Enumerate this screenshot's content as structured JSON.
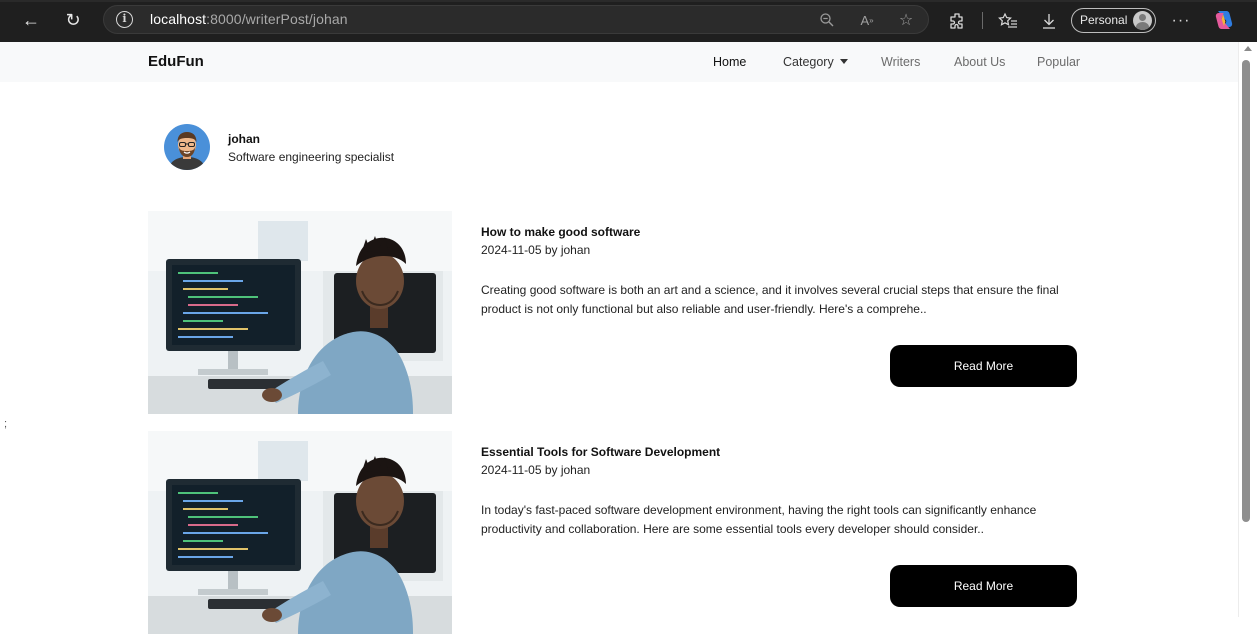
{
  "browser": {
    "url_host": "localhost",
    "url_path": ":8000/writerPost/johan",
    "profile_label": "Personal",
    "icons": [
      "back-arrow-icon",
      "reload-icon",
      "info-icon",
      "zoom-icon",
      "read-aloud-icon",
      "favorite-star-icon",
      "extensions-icon",
      "favorites-icon",
      "download-icon",
      "more-icon",
      "copilot-icon"
    ]
  },
  "navbar": {
    "brand": "EduFun",
    "links": {
      "home": "Home",
      "category": "Category",
      "writers": "Writers",
      "about": "About Us",
      "popular": "Popular"
    }
  },
  "stray_text": ";",
  "writer": {
    "name": "johan",
    "role": "Software engineering specialist"
  },
  "posts": [
    {
      "title": "How to make good software",
      "meta": "2024-11-05 by johan",
      "excerpt": "Creating good software is both an art and a science, and it involves several crucial steps that ensure the final product is not only functional but also reliable and user-friendly. Here's a comprehe..",
      "button": "Read More"
    },
    {
      "title": "Essential Tools for Software Development",
      "meta": "2024-11-05 by johan",
      "excerpt": "In today's fast-paced software development environment, having the right tools can significantly enhance productivity and collaboration. Here are some essential tools every developer should consider..",
      "button": "Read More"
    }
  ],
  "colors": {
    "chrome_bg": "#1f1f1f",
    "nav_bg": "#f8f9fa",
    "button_bg": "#000000",
    "button_text": "#ffffff"
  }
}
